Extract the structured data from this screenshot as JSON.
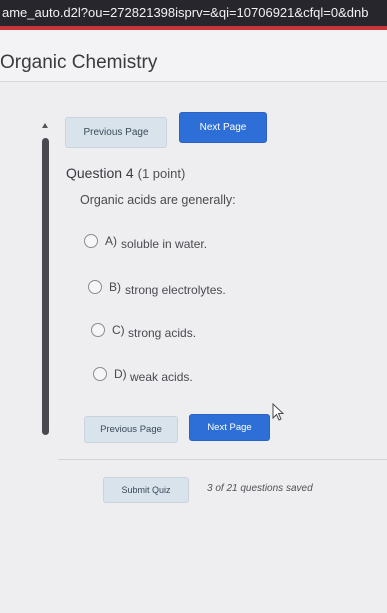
{
  "browser": {
    "url": "ame_auto.d2l?ou=272821398isprv=&qi=10706921&cfql=0&dnb"
  },
  "header": {
    "course_title": "Organic Chemistry"
  },
  "nav": {
    "previous_label": "Previous Page",
    "next_label": "Next Page"
  },
  "question": {
    "title": "Question 4",
    "points": "(1 point)",
    "text": "Organic acids are generally:",
    "options": [
      {
        "letter": "A)",
        "text": "soluble in water."
      },
      {
        "letter": "B)",
        "text": "strong electrolytes."
      },
      {
        "letter": "C)",
        "text": "strong acids."
      },
      {
        "letter": "D)",
        "text": "weak acids."
      }
    ]
  },
  "footer": {
    "submit_label": "Submit Quiz",
    "save_status": "3 of 21 questions saved"
  },
  "icons": {
    "cursor": "mouse-pointer-icon",
    "scroll_up": "scroll-up-arrow-icon"
  }
}
